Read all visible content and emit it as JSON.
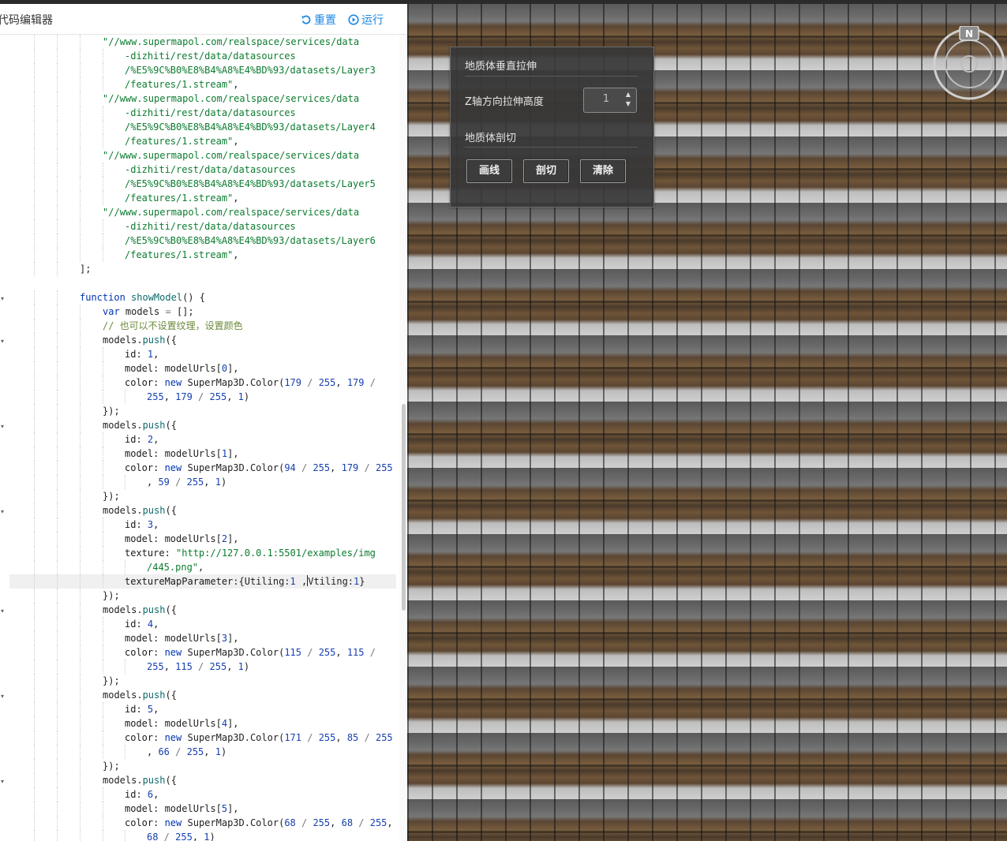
{
  "editor": {
    "title": "代码编辑器",
    "reset_label": "重置",
    "run_label": "运行",
    "accent_color": "#1e88e5"
  },
  "code": {
    "lines": [
      [
        {
          "t": "\"//www.supermapol.com/realspace/services/data",
          "c": "str"
        }
      ],
      [
        {
          "t": "-dizhiti/rest/data/datasources",
          "c": "str"
        }
      ],
      [
        {
          "t": "/%E5%9C%B0%E8%B4%A8%E4%BD%93/datasets/Layer3",
          "c": "str"
        }
      ],
      [
        {
          "t": "/features/1.stream\"",
          "c": "str"
        },
        {
          "t": ",",
          "c": "txt"
        }
      ],
      [
        {
          "t": "\"//www.supermapol.com/realspace/services/data",
          "c": "str"
        }
      ],
      [
        {
          "t": "-dizhiti/rest/data/datasources",
          "c": "str"
        }
      ],
      [
        {
          "t": "/%E5%9C%B0%E8%B4%A8%E4%BD%93/datasets/Layer4",
          "c": "str"
        }
      ],
      [
        {
          "t": "/features/1.stream\"",
          "c": "str"
        },
        {
          "t": ",",
          "c": "txt"
        }
      ],
      [
        {
          "t": "\"//www.supermapol.com/realspace/services/data",
          "c": "str"
        }
      ],
      [
        {
          "t": "-dizhiti/rest/data/datasources",
          "c": "str"
        }
      ],
      [
        {
          "t": "/%E5%9C%B0%E8%B4%A8%E4%BD%93/datasets/Layer5",
          "c": "str"
        }
      ],
      [
        {
          "t": "/features/1.stream\"",
          "c": "str"
        },
        {
          "t": ",",
          "c": "txt"
        }
      ],
      [
        {
          "t": "\"//www.supermapol.com/realspace/services/data",
          "c": "str"
        }
      ],
      [
        {
          "t": "-dizhiti/rest/data/datasources",
          "c": "str"
        }
      ],
      [
        {
          "t": "/%E5%9C%B0%E8%B4%A8%E4%BD%93/datasets/Layer6",
          "c": "str"
        }
      ],
      [
        {
          "t": "/features/1.stream\"",
          "c": "str"
        },
        {
          "t": ",",
          "c": "txt"
        }
      ],
      [
        {
          "t": "];",
          "c": "txt"
        }
      ],
      [],
      [
        {
          "t": "function",
          "c": "kw"
        },
        {
          "t": " ",
          "c": "txt"
        },
        {
          "t": "showModel",
          "c": "fn"
        },
        {
          "t": "() {",
          "c": "txt"
        }
      ],
      [
        {
          "t": "var",
          "c": "kw"
        },
        {
          "t": " models ",
          "c": "txt"
        },
        {
          "t": "=",
          "c": "op"
        },
        {
          "t": " [];",
          "c": "txt"
        }
      ],
      [
        {
          "t": "// 也可以不设置纹理，设置颜色",
          "c": "com"
        }
      ],
      [
        {
          "t": "models.",
          "c": "txt"
        },
        {
          "t": "push",
          "c": "fn"
        },
        {
          "t": "({",
          "c": "txt"
        }
      ],
      [
        {
          "t": "id",
          "c": "prop"
        },
        {
          "t": ": ",
          "c": "txt"
        },
        {
          "t": "1",
          "c": "num"
        },
        {
          "t": ",",
          "c": "txt"
        }
      ],
      [
        {
          "t": "model",
          "c": "prop"
        },
        {
          "t": ": modelUrls[",
          "c": "txt"
        },
        {
          "t": "0",
          "c": "num"
        },
        {
          "t": "],",
          "c": "txt"
        }
      ],
      [
        {
          "t": "color",
          "c": "prop"
        },
        {
          "t": ": ",
          "c": "txt"
        },
        {
          "t": "new",
          "c": "kw"
        },
        {
          "t": " SuperMap3D.Color(",
          "c": "txt"
        },
        {
          "t": "179",
          "c": "num"
        },
        {
          "t": " / ",
          "c": "op"
        },
        {
          "t": "255",
          "c": "num"
        },
        {
          "t": ", ",
          "c": "txt"
        },
        {
          "t": "179",
          "c": "num"
        },
        {
          "t": " /",
          "c": "op"
        }
      ],
      [
        {
          "t": "255",
          "c": "num"
        },
        {
          "t": ", ",
          "c": "txt"
        },
        {
          "t": "179",
          "c": "num"
        },
        {
          "t": " / ",
          "c": "op"
        },
        {
          "t": "255",
          "c": "num"
        },
        {
          "t": ", ",
          "c": "txt"
        },
        {
          "t": "1",
          "c": "num"
        },
        {
          "t": ")",
          "c": "txt"
        }
      ],
      [
        {
          "t": "});",
          "c": "txt"
        }
      ],
      [
        {
          "t": "models.",
          "c": "txt"
        },
        {
          "t": "push",
          "c": "fn"
        },
        {
          "t": "({",
          "c": "txt"
        }
      ],
      [
        {
          "t": "id",
          "c": "prop"
        },
        {
          "t": ": ",
          "c": "txt"
        },
        {
          "t": "2",
          "c": "num"
        },
        {
          "t": ",",
          "c": "txt"
        }
      ],
      [
        {
          "t": "model",
          "c": "prop"
        },
        {
          "t": ": modelUrls[",
          "c": "txt"
        },
        {
          "t": "1",
          "c": "num"
        },
        {
          "t": "],",
          "c": "txt"
        }
      ],
      [
        {
          "t": "color",
          "c": "prop"
        },
        {
          "t": ": ",
          "c": "txt"
        },
        {
          "t": "new",
          "c": "kw"
        },
        {
          "t": " SuperMap3D.Color(",
          "c": "txt"
        },
        {
          "t": "94",
          "c": "num"
        },
        {
          "t": " / ",
          "c": "op"
        },
        {
          "t": "255",
          "c": "num"
        },
        {
          "t": ", ",
          "c": "txt"
        },
        {
          "t": "179",
          "c": "num"
        },
        {
          "t": " / ",
          "c": "op"
        },
        {
          "t": "255",
          "c": "num"
        }
      ],
      [
        {
          "t": ", ",
          "c": "txt"
        },
        {
          "t": "59",
          "c": "num"
        },
        {
          "t": " / ",
          "c": "op"
        },
        {
          "t": "255",
          "c": "num"
        },
        {
          "t": ", ",
          "c": "txt"
        },
        {
          "t": "1",
          "c": "num"
        },
        {
          "t": ")",
          "c": "txt"
        }
      ],
      [
        {
          "t": "});",
          "c": "txt"
        }
      ],
      [
        {
          "t": "models.",
          "c": "txt"
        },
        {
          "t": "push",
          "c": "fn"
        },
        {
          "t": "({",
          "c": "txt"
        }
      ],
      [
        {
          "t": "id",
          "c": "prop"
        },
        {
          "t": ": ",
          "c": "txt"
        },
        {
          "t": "3",
          "c": "num"
        },
        {
          "t": ",",
          "c": "txt"
        }
      ],
      [
        {
          "t": "model",
          "c": "prop"
        },
        {
          "t": ": modelUrls[",
          "c": "txt"
        },
        {
          "t": "2",
          "c": "num"
        },
        {
          "t": "],",
          "c": "txt"
        }
      ],
      [
        {
          "t": "texture",
          "c": "prop"
        },
        {
          "t": ": ",
          "c": "txt"
        },
        {
          "t": "\"http://127.0.0.1:5501/examples/img",
          "c": "str"
        }
      ],
      [
        {
          "t": "/445.png\"",
          "c": "str"
        },
        {
          "t": ",",
          "c": "txt"
        }
      ],
      [
        {
          "t": "textureMapParameter",
          "c": "prop"
        },
        {
          "t": ":{Utiling:",
          "c": "txt"
        },
        {
          "t": "1",
          "c": "num"
        },
        {
          "t": " ,",
          "c": "txt"
        },
        {
          "t": "|",
          "c": "cursor"
        },
        {
          "t": "Vtiling:",
          "c": "txt"
        },
        {
          "t": "1",
          "c": "num"
        },
        {
          "t": "}",
          "c": "txt"
        }
      ],
      [
        {
          "t": "});",
          "c": "txt"
        }
      ],
      [
        {
          "t": "models.",
          "c": "txt"
        },
        {
          "t": "push",
          "c": "fn"
        },
        {
          "t": "({",
          "c": "txt"
        }
      ],
      [
        {
          "t": "id",
          "c": "prop"
        },
        {
          "t": ": ",
          "c": "txt"
        },
        {
          "t": "4",
          "c": "num"
        },
        {
          "t": ",",
          "c": "txt"
        }
      ],
      [
        {
          "t": "model",
          "c": "prop"
        },
        {
          "t": ": modelUrls[",
          "c": "txt"
        },
        {
          "t": "3",
          "c": "num"
        },
        {
          "t": "],",
          "c": "txt"
        }
      ],
      [
        {
          "t": "color",
          "c": "prop"
        },
        {
          "t": ": ",
          "c": "txt"
        },
        {
          "t": "new",
          "c": "kw"
        },
        {
          "t": " SuperMap3D.Color(",
          "c": "txt"
        },
        {
          "t": "115",
          "c": "num"
        },
        {
          "t": " / ",
          "c": "op"
        },
        {
          "t": "255",
          "c": "num"
        },
        {
          "t": ", ",
          "c": "txt"
        },
        {
          "t": "115",
          "c": "num"
        },
        {
          "t": " /",
          "c": "op"
        }
      ],
      [
        {
          "t": "255",
          "c": "num"
        },
        {
          "t": ", ",
          "c": "txt"
        },
        {
          "t": "115",
          "c": "num"
        },
        {
          "t": " / ",
          "c": "op"
        },
        {
          "t": "255",
          "c": "num"
        },
        {
          "t": ", ",
          "c": "txt"
        },
        {
          "t": "1",
          "c": "num"
        },
        {
          "t": ")",
          "c": "txt"
        }
      ],
      [
        {
          "t": "});",
          "c": "txt"
        }
      ],
      [
        {
          "t": "models.",
          "c": "txt"
        },
        {
          "t": "push",
          "c": "fn"
        },
        {
          "t": "({",
          "c": "txt"
        }
      ],
      [
        {
          "t": "id",
          "c": "prop"
        },
        {
          "t": ": ",
          "c": "txt"
        },
        {
          "t": "5",
          "c": "num"
        },
        {
          "t": ",",
          "c": "txt"
        }
      ],
      [
        {
          "t": "model",
          "c": "prop"
        },
        {
          "t": ": modelUrls[",
          "c": "txt"
        },
        {
          "t": "4",
          "c": "num"
        },
        {
          "t": "],",
          "c": "txt"
        }
      ],
      [
        {
          "t": "color",
          "c": "prop"
        },
        {
          "t": ": ",
          "c": "txt"
        },
        {
          "t": "new",
          "c": "kw"
        },
        {
          "t": " SuperMap3D.Color(",
          "c": "txt"
        },
        {
          "t": "171",
          "c": "num"
        },
        {
          "t": " / ",
          "c": "op"
        },
        {
          "t": "255",
          "c": "num"
        },
        {
          "t": ", ",
          "c": "txt"
        },
        {
          "t": "85",
          "c": "num"
        },
        {
          "t": " / ",
          "c": "op"
        },
        {
          "t": "255",
          "c": "num"
        }
      ],
      [
        {
          "t": ", ",
          "c": "txt"
        },
        {
          "t": "66",
          "c": "num"
        },
        {
          "t": " / ",
          "c": "op"
        },
        {
          "t": "255",
          "c": "num"
        },
        {
          "t": ", ",
          "c": "txt"
        },
        {
          "t": "1",
          "c": "num"
        },
        {
          "t": ")",
          "c": "txt"
        }
      ],
      [
        {
          "t": "});",
          "c": "txt"
        }
      ],
      [
        {
          "t": "models.",
          "c": "txt"
        },
        {
          "t": "push",
          "c": "fn"
        },
        {
          "t": "({",
          "c": "txt"
        }
      ],
      [
        {
          "t": "id",
          "c": "prop"
        },
        {
          "t": ": ",
          "c": "txt"
        },
        {
          "t": "6",
          "c": "num"
        },
        {
          "t": ",",
          "c": "txt"
        }
      ],
      [
        {
          "t": "model",
          "c": "prop"
        },
        {
          "t": ": modelUrls[",
          "c": "txt"
        },
        {
          "t": "5",
          "c": "num"
        },
        {
          "t": "],",
          "c": "txt"
        }
      ],
      [
        {
          "t": "color",
          "c": "prop"
        },
        {
          "t": ": ",
          "c": "txt"
        },
        {
          "t": "new",
          "c": "kw"
        },
        {
          "t": " SuperMap3D.Color(",
          "c": "txt"
        },
        {
          "t": "68",
          "c": "num"
        },
        {
          "t": " / ",
          "c": "op"
        },
        {
          "t": "255",
          "c": "num"
        },
        {
          "t": ", ",
          "c": "txt"
        },
        {
          "t": "68",
          "c": "num"
        },
        {
          "t": " / ",
          "c": "op"
        },
        {
          "t": "255",
          "c": "num"
        },
        {
          "t": ",",
          "c": "txt"
        }
      ],
      [
        {
          "t": "68",
          "c": "num"
        },
        {
          "t": " / ",
          "c": "op"
        },
        {
          "t": "255",
          "c": "num"
        },
        {
          "t": ", ",
          "c": "txt"
        },
        {
          "t": "1",
          "c": "num"
        },
        {
          "t": ")",
          "c": "txt"
        }
      ]
    ]
  },
  "panel": {
    "stretch_title": "地质体垂直拉伸",
    "z_label": "Z轴方向拉伸高度",
    "z_value": "1",
    "section_title": "地质体剖切",
    "btn_draw": "画线",
    "btn_cut": "剖切",
    "btn_clear": "清除"
  },
  "compass": {
    "north_label": "N"
  }
}
